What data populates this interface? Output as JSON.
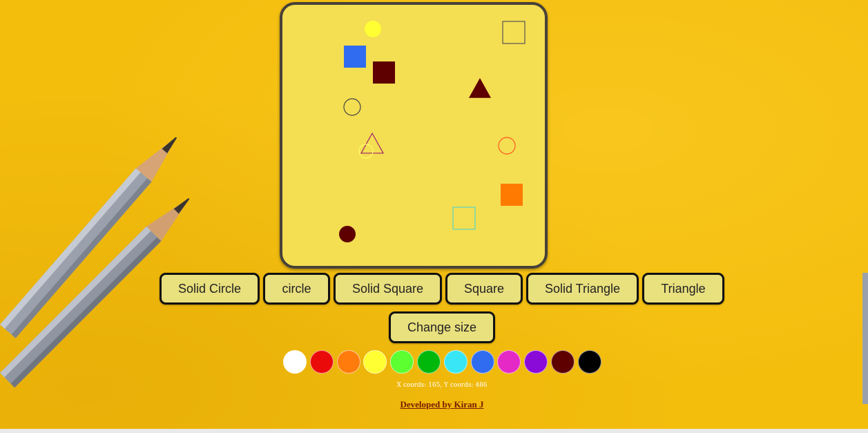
{
  "canvas": {
    "shapes": [
      {
        "kind": "solid-circle",
        "color": "#ffff33"
      },
      {
        "kind": "square",
        "color": "#555555"
      },
      {
        "kind": "solid-square",
        "color": "#2f6cf0"
      },
      {
        "kind": "solid-square",
        "color": "#5e0000"
      },
      {
        "kind": "solid-triangle",
        "color": "#5e0000"
      },
      {
        "kind": "circle",
        "color": "#444444"
      },
      {
        "kind": "triangle",
        "color": "#a0226a"
      },
      {
        "kind": "circle",
        "color": "#ffff66"
      },
      {
        "kind": "circle",
        "color": "#ff5a1f"
      },
      {
        "kind": "solid-square",
        "color": "#ff7a00"
      },
      {
        "kind": "square",
        "color": "#59d6c7"
      },
      {
        "kind": "solid-circle",
        "color": "#5e0000"
      }
    ]
  },
  "toolbar": {
    "solid_circle": "Solid Circle",
    "circle": "circle",
    "solid_square": "Solid Square",
    "square": "Square",
    "solid_triangle": "Solid Triangle",
    "triangle": "Triangle",
    "change_size": "Change size"
  },
  "palette": [
    {
      "name": "white",
      "hex": "#ffffff"
    },
    {
      "name": "red",
      "hex": "#ea0a0a"
    },
    {
      "name": "orange",
      "hex": "#ff7b0c"
    },
    {
      "name": "yellow",
      "hex": "#ffff33"
    },
    {
      "name": "lime",
      "hex": "#5cff30"
    },
    {
      "name": "green",
      "hex": "#00b80c"
    },
    {
      "name": "cyan",
      "hex": "#38e6f5"
    },
    {
      "name": "blue",
      "hex": "#2f6cf0"
    },
    {
      "name": "pink",
      "hex": "#e529c7"
    },
    {
      "name": "purple",
      "hex": "#8a0ad8"
    },
    {
      "name": "maroon",
      "hex": "#5e0000"
    },
    {
      "name": "black",
      "hex": "#000000"
    }
  ],
  "status": {
    "coords": "X coords: 165, Y coords: 486"
  },
  "footer": {
    "developer": "Developed by Kiran J"
  }
}
